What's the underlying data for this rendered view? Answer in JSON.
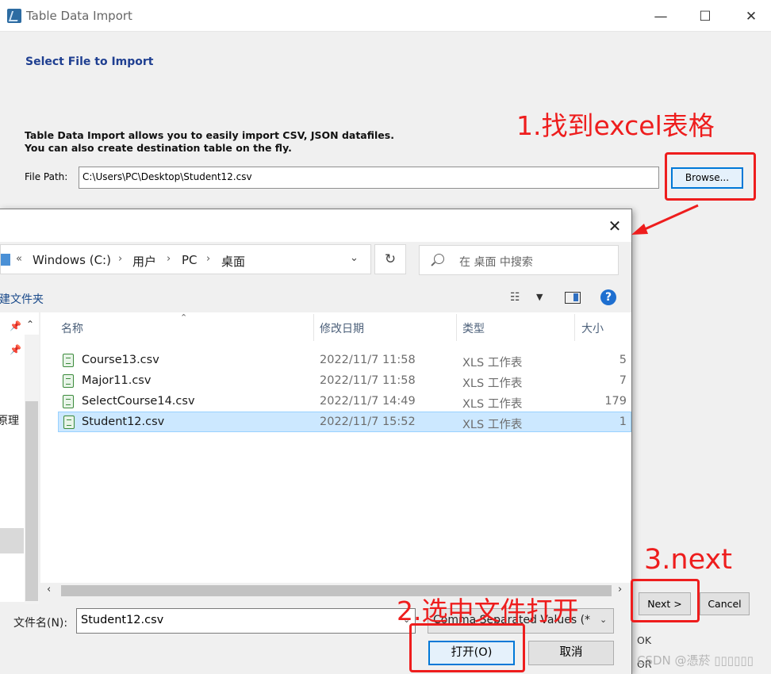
{
  "window": {
    "title": "Table Data Import",
    "minimize_glyph": "—",
    "maximize_glyph": "☐",
    "close_glyph": "✕"
  },
  "wizard": {
    "heading": "Select File to Import",
    "description_line1": "Table Data Import allows you to easily import CSV, JSON datafiles.",
    "description_line2": "You can also create destination table on the fly.",
    "file_path_label": "File Path:",
    "file_path_value": "C:\\Users\\PC\\Desktop\\Student12.csv",
    "browse_label": "Browse...",
    "next_label": "Next >",
    "cancel_label": "Cancel",
    "status_lines": [
      "OK",
      "OR"
    ]
  },
  "dialog": {
    "close_glyph": "✕",
    "address": {
      "overflow": "«",
      "crumbs": [
        "Windows (C:)",
        "用户",
        "PC",
        "桌面"
      ],
      "separator": "›",
      "dropdown_glyph": "⌄"
    },
    "refresh_glyph": "↻",
    "search_placeholder": "在 桌面 中搜索",
    "new_folder_label": "新建文件夹",
    "view_glyph": "☷",
    "view_dropdown_glyph": "▼",
    "help_glyph": "?",
    "nav": {
      "scroll_up": "⌃",
      "scroll_down": "⌄",
      "pin_glyph": "📌",
      "visible_label": "原理"
    },
    "columns": [
      "名称",
      "修改日期",
      "类型",
      "大小"
    ],
    "sort_glyph": "⌃",
    "files": [
      {
        "name": "Course13.csv",
        "date": "2022/11/7 11:58",
        "type": "XLS 工作表",
        "size": "5"
      },
      {
        "name": "Major11.csv",
        "date": "2022/11/7 11:58",
        "type": "XLS 工作表",
        "size": "7"
      },
      {
        "name": "SelectCourse14.csv",
        "date": "2022/11/7 14:49",
        "type": "XLS 工作表",
        "size": "179"
      },
      {
        "name": "Student12.csv",
        "date": "2022/11/7 15:52",
        "type": "XLS 工作表",
        "size": "1"
      }
    ],
    "selected_file_index": 3,
    "hscroll_left": "‹",
    "hscroll_right": "›",
    "filename_label": "文件名(N):",
    "filename_value": "Student12.csv",
    "filename_dropdown_glyph": "⌄",
    "filetype_value": "Comma Separated Values (*",
    "filetype_dropdown_glyph": "⌄",
    "open_label": "打开(O)",
    "cancel_label": "取消"
  },
  "annotations": {
    "step1": "1.找到excel表格",
    "step2": "2.选中文件打开",
    "step3": "3.next",
    "color": "#ee1d1d"
  },
  "watermark": "CSDN @憑菸 ▯▯▯▯▯▯"
}
